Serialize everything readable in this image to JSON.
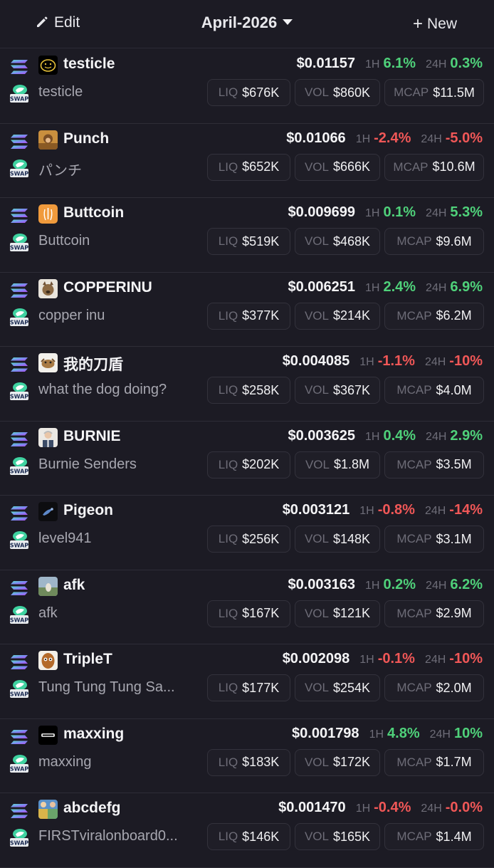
{
  "header": {
    "edit_label": "Edit",
    "month_label": "April-2026",
    "new_label": "New",
    "icons": [
      "pencil-icon",
      "caret-down-icon",
      "plus-icon"
    ]
  },
  "labels": {
    "h1": "1H",
    "h24": "24H",
    "liq": "LIQ",
    "vol": "VOL",
    "mcap": "MCAP"
  },
  "badges": {
    "chain_icon": "solana-icon",
    "swap_icon": "swap-icon",
    "swap_text": "SWAP"
  },
  "colors": {
    "up": "#4fd17a",
    "down": "#f05757",
    "background": "#1c1b24"
  },
  "tokens": [
    {
      "symbol": "testicle",
      "name": "testicle",
      "price": "$0.01157",
      "h1": "6.1%",
      "h1_dir": "up",
      "h24": "0.3%",
      "h24_dir": "up",
      "liq": "$676K",
      "vol": "$860K",
      "mcap": "$11.5M",
      "avatar": "smiley-avatar"
    },
    {
      "symbol": "Punch",
      "name": "パンチ",
      "price": "$0.01066",
      "h1": "-2.4%",
      "h1_dir": "down",
      "h24": "-5.0%",
      "h24_dir": "down",
      "liq": "$652K",
      "vol": "$666K",
      "mcap": "$10.6M",
      "avatar": "monkey-avatar"
    },
    {
      "symbol": "Buttcoin",
      "name": "Buttcoin",
      "price": "$0.009699",
      "h1": "0.1%",
      "h1_dir": "up",
      "h24": "5.3%",
      "h24_dir": "up",
      "liq": "$519K",
      "vol": "$468K",
      "mcap": "$9.6M",
      "avatar": "buttcoin-avatar"
    },
    {
      "symbol": "COPPERINU",
      "name": "copper inu",
      "price": "$0.006251",
      "h1": "2.4%",
      "h1_dir": "up",
      "h24": "6.9%",
      "h24_dir": "up",
      "liq": "$377K",
      "vol": "$214K",
      "mcap": "$6.2M",
      "avatar": "dog-avatar"
    },
    {
      "symbol": "我的刀盾",
      "name": "what the dog doing?",
      "price": "$0.004085",
      "h1": "-1.1%",
      "h1_dir": "down",
      "h24": "-10%",
      "h24_dir": "down",
      "liq": "$258K",
      "vol": "$367K",
      "mcap": "$4.0M",
      "avatar": "dog-cartoon-avatar"
    },
    {
      "symbol": "BURNIE",
      "name": "Burnie Senders",
      "price": "$0.003625",
      "h1": "0.4%",
      "h1_dir": "up",
      "h24": "2.9%",
      "h24_dir": "up",
      "liq": "$202K",
      "vol": "$1.8M",
      "mcap": "$3.5M",
      "avatar": "man-avatar"
    },
    {
      "symbol": "Pigeon",
      "name": "level941",
      "price": "$0.003121",
      "h1": "-0.8%",
      "h1_dir": "down",
      "h24": "-14%",
      "h24_dir": "down",
      "liq": "$256K",
      "vol": "$148K",
      "mcap": "$3.1M",
      "avatar": "pigeon-avatar"
    },
    {
      "symbol": "afk",
      "name": "afk",
      "price": "$0.003163",
      "h1": "0.2%",
      "h1_dir": "up",
      "h24": "6.2%",
      "h24_dir": "up",
      "liq": "$167K",
      "vol": "$121K",
      "mcap": "$2.9M",
      "avatar": "landscape-avatar"
    },
    {
      "symbol": "TripleT",
      "name": "Tung Tung Tung Sa...",
      "price": "$0.002098",
      "h1": "-0.1%",
      "h1_dir": "down",
      "h24": "-10%",
      "h24_dir": "down",
      "liq": "$177K",
      "vol": "$254K",
      "mcap": "$2.0M",
      "avatar": "wood-character-avatar"
    },
    {
      "symbol": "maxxing",
      "name": "maxxing",
      "price": "$0.001798",
      "h1": "4.8%",
      "h1_dir": "up",
      "h24": "10%",
      "h24_dir": "up",
      "liq": "$183K",
      "vol": "$172K",
      "mcap": "$1.7M",
      "avatar": "black-logo-avatar"
    },
    {
      "symbol": "abcdefg",
      "name": "FIRSTviralonboard0...",
      "price": "$0.001470",
      "h1": "-0.4%",
      "h1_dir": "down",
      "h24": "-0.0%",
      "h24_dir": "down",
      "liq": "$146K",
      "vol": "$165K",
      "mcap": "$1.4M",
      "avatar": "collage-avatar"
    }
  ]
}
